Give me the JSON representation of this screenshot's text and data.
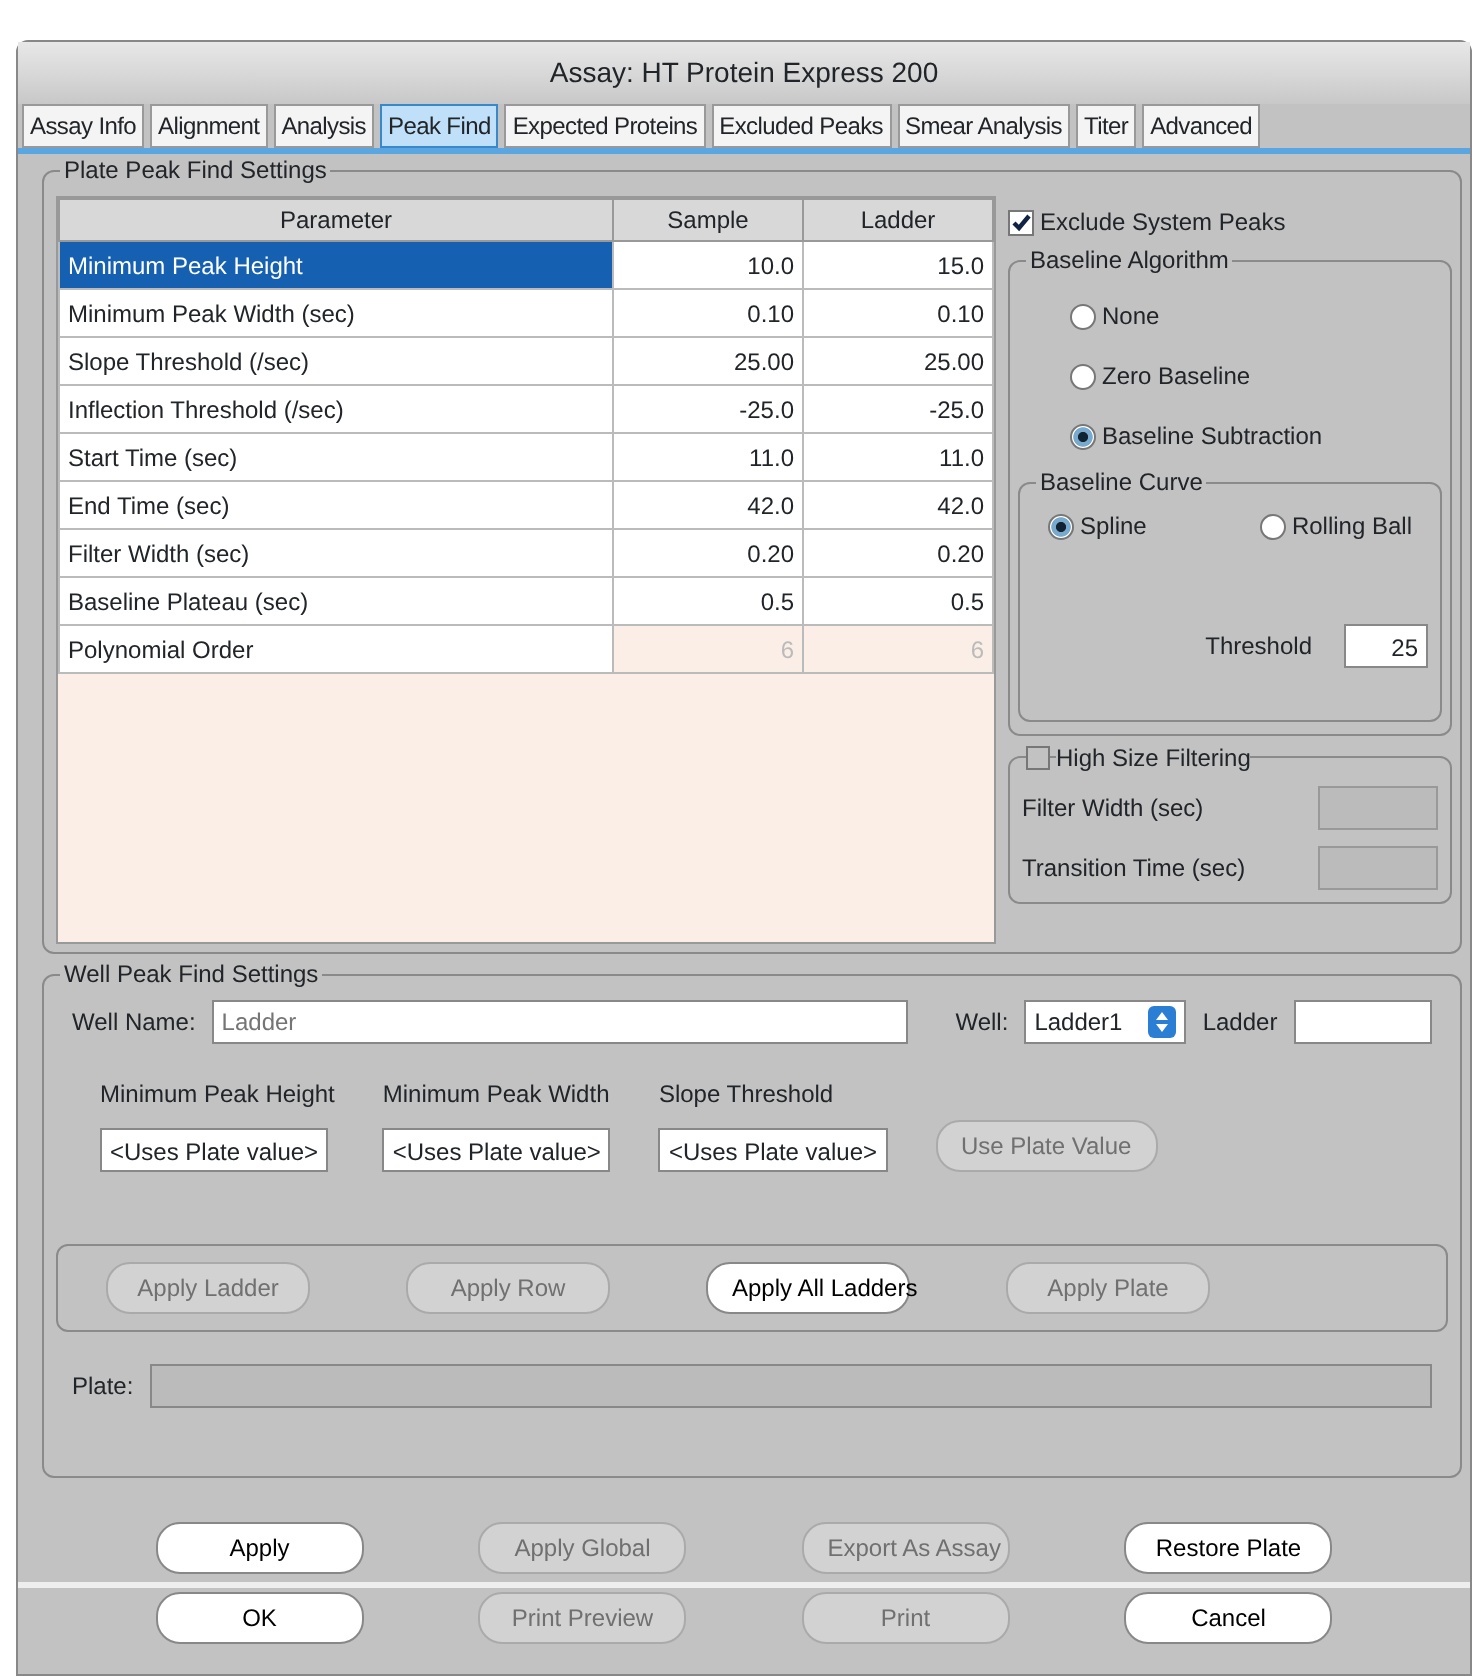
{
  "window": {
    "title": "Assay: HT Protein Express 200"
  },
  "tabs": [
    {
      "label": "Assay Info",
      "selected": false
    },
    {
      "label": "Alignment",
      "selected": false
    },
    {
      "label": "Analysis",
      "selected": false
    },
    {
      "label": "Peak Find",
      "selected": true
    },
    {
      "label": "Expected Proteins",
      "selected": false
    },
    {
      "label": "Excluded Peaks",
      "selected": false
    },
    {
      "label": "Smear Analysis",
      "selected": false
    },
    {
      "label": "Titer",
      "selected": false
    },
    {
      "label": "Advanced",
      "selected": false
    }
  ],
  "plate_settings": {
    "title": "Plate Peak Find Settings",
    "table": {
      "columns": [
        "Parameter",
        "Sample",
        "Ladder"
      ],
      "rows": [
        {
          "cells": [
            "Minimum Peak Height",
            "10.0",
            "15.0"
          ],
          "selected": true,
          "disabled": false
        },
        {
          "cells": [
            "Minimum Peak Width (sec)",
            "0.10",
            "0.10"
          ],
          "selected": false,
          "disabled": false
        },
        {
          "cells": [
            "Slope Threshold (/sec)",
            "25.00",
            "25.00"
          ],
          "selected": false,
          "disabled": false
        },
        {
          "cells": [
            "Inflection Threshold (/sec)",
            "-25.0",
            "-25.0"
          ],
          "selected": false,
          "disabled": false
        },
        {
          "cells": [
            "Start Time (sec)",
            "11.0",
            "11.0"
          ],
          "selected": false,
          "disabled": false
        },
        {
          "cells": [
            "End Time (sec)",
            "42.0",
            "42.0"
          ],
          "selected": false,
          "disabled": false
        },
        {
          "cells": [
            "Filter Width (sec)",
            "0.20",
            "0.20"
          ],
          "selected": false,
          "disabled": false
        },
        {
          "cells": [
            "Baseline Plateau (sec)",
            "0.5",
            "0.5"
          ],
          "selected": false,
          "disabled": false
        },
        {
          "cells": [
            "Polynomial Order",
            "6",
            "6"
          ],
          "selected": false,
          "disabled": true
        }
      ]
    },
    "exclude_system_peaks": {
      "label": "Exclude System Peaks",
      "checked": true
    },
    "baseline_algorithm": {
      "title": "Baseline Algorithm",
      "options": [
        {
          "label": "None",
          "selected": false
        },
        {
          "label": "Zero Baseline",
          "selected": false
        },
        {
          "label": "Baseline Subtraction",
          "selected": true
        }
      ]
    },
    "baseline_curve": {
      "title": "Baseline Curve",
      "options": [
        {
          "label": "Spline",
          "selected": true
        },
        {
          "label": "Rolling Ball",
          "selected": false
        }
      ],
      "threshold_label": "Threshold",
      "threshold_value": "25"
    },
    "high_size_filtering": {
      "label": "High Size Filtering",
      "checked": false,
      "fields": [
        "Filter Width (sec)",
        "Transition Time (sec)"
      ]
    }
  },
  "well_settings": {
    "title": "Well Peak Find Settings",
    "well_name_label": "Well Name:",
    "well_name_placeholder": "Ladder",
    "well_label": "Well:",
    "well_value": "Ladder1",
    "ladder_label": "Ladder",
    "fields": [
      {
        "label": "Minimum Peak Height",
        "value": "<Uses Plate value>"
      },
      {
        "label": "Minimum Peak Width",
        "value": "<Uses Plate value>"
      },
      {
        "label": "Slope Threshold",
        "value": "<Uses Plate value>"
      }
    ],
    "use_plate_value": {
      "label": "Use Plate Value",
      "disabled": true
    },
    "apply_buttons": [
      {
        "label": "Apply Ladder",
        "disabled": true
      },
      {
        "label": "Apply Row",
        "disabled": true
      },
      {
        "label": "Apply All Ladders",
        "disabled": false
      },
      {
        "label": "Apply Plate",
        "disabled": true
      }
    ],
    "plate_label": "Plate:"
  },
  "bottom_buttons": [
    [
      {
        "label": "Apply",
        "disabled": false
      },
      {
        "label": "Apply Global",
        "disabled": true
      },
      {
        "label": "Export As Assay",
        "disabled": true
      },
      {
        "label": "Restore Plate",
        "disabled": false
      }
    ],
    [
      {
        "label": "OK",
        "disabled": false
      },
      {
        "label": "Print Preview",
        "disabled": true
      },
      {
        "label": "Print",
        "disabled": true
      },
      {
        "label": "Cancel",
        "disabled": false
      }
    ]
  ]
}
